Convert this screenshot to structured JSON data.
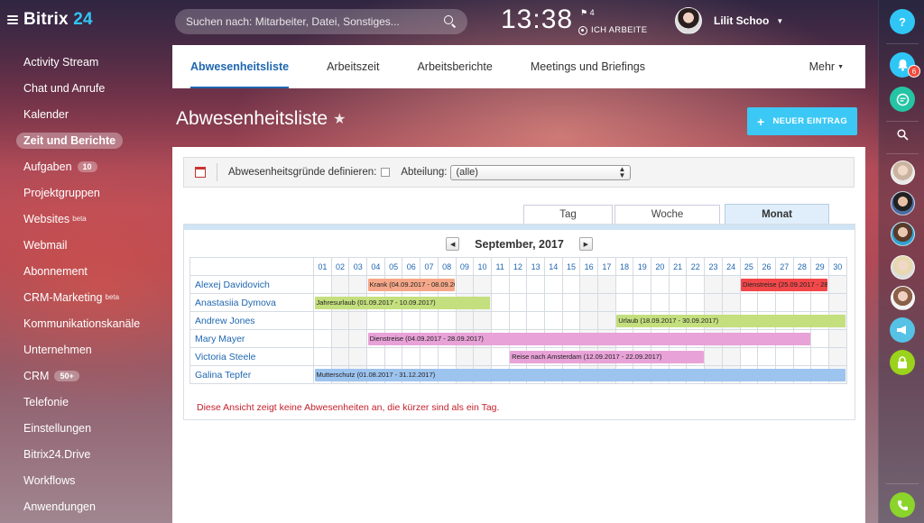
{
  "app": {
    "logo_prefix": "Bitrix",
    "logo_suffix": "24"
  },
  "sidebar": {
    "items": [
      {
        "label": "Activity Stream"
      },
      {
        "label": "Chat und Anrufe"
      },
      {
        "label": "Kalender"
      },
      {
        "label": "Zeit und Berichte",
        "active": true
      },
      {
        "label": "Aufgaben",
        "badge": "10"
      },
      {
        "label": "Projektgruppen"
      },
      {
        "label": "Websites",
        "sup": "beta"
      },
      {
        "label": "Webmail"
      },
      {
        "label": "Abonnement"
      },
      {
        "label": "CRM-Marketing",
        "sup": "beta"
      },
      {
        "label": "Kommunikationskanäle"
      },
      {
        "label": "Unternehmen"
      },
      {
        "label": "CRM",
        "badge": "50+"
      },
      {
        "label": "Telefonie"
      },
      {
        "label": "Einstellungen"
      },
      {
        "label": "Bitrix24.Drive"
      },
      {
        "label": "Workflows"
      },
      {
        "label": "Anwendungen"
      }
    ]
  },
  "header": {
    "search_placeholder": "Suchen nach: Mitarbeiter, Datei, Sonstiges...",
    "clock": "13:38",
    "flag_count": "4",
    "work_status": "ICH ARBEITE",
    "user_name": "Lilit Schoo"
  },
  "rightbar": {
    "help": "?",
    "notifications_count": "6"
  },
  "nav": {
    "tabs": [
      "Abwesenheitsliste",
      "Arbeitszeit",
      "Arbeitsberichte",
      "Meetings und Briefings"
    ],
    "active": 0,
    "more": "Mehr"
  },
  "page": {
    "title": "Abwesenheitsliste",
    "new_button": "NEUER EINTRAG"
  },
  "filter": {
    "reasons_label": "Abwesenheitsgründe definieren:",
    "department_label": "Abteilung:",
    "department_value": "(alle)"
  },
  "view_tabs": {
    "day": "Tag",
    "week": "Woche",
    "month": "Monat",
    "active": "month"
  },
  "calendar": {
    "month_title": "September, 2017",
    "days": [
      "01",
      "02",
      "03",
      "04",
      "05",
      "06",
      "07",
      "08",
      "09",
      "10",
      "11",
      "12",
      "13",
      "14",
      "15",
      "16",
      "17",
      "18",
      "19",
      "20",
      "21",
      "22",
      "23",
      "24",
      "25",
      "26",
      "27",
      "28",
      "29",
      "30"
    ],
    "weekend_days": [
      2,
      3,
      9,
      10,
      16,
      17,
      23,
      24,
      30
    ],
    "employees": [
      {
        "name": "Alexej Davidovich",
        "absences": [
          {
            "label": "Krank (04.09.2017 - 08.09.2017)",
            "start": 4,
            "end": 8,
            "color": "#f5a889"
          },
          {
            "label": "Dienstreise (25.09.2017 - 28.09.2017)",
            "start": 25,
            "end": 29,
            "color": "#f2484a"
          }
        ]
      },
      {
        "name": "Anastasiia Dymova",
        "absences": [
          {
            "label": "Jahresurlaub (01.09.2017 - 10.09.2017)",
            "start": 1,
            "end": 10,
            "color": "#c4df7e"
          }
        ]
      },
      {
        "name": "Andrew Jones",
        "absences": [
          {
            "label": "Urlaub (18.09.2017 - 30.09.2017)",
            "start": 18,
            "end": 30,
            "color": "#c4df7e"
          }
        ]
      },
      {
        "name": "Mary Mayer",
        "absences": [
          {
            "label": "Dienstreise (04.09.2017 - 28.09.2017)",
            "start": 4,
            "end": 28,
            "color": "#e8a2d8"
          }
        ]
      },
      {
        "name": "Victoria Steele",
        "absences": [
          {
            "label": "Reise nach Amsterdam (12.09.2017 - 22.09.2017)",
            "start": 12,
            "end": 22,
            "color": "#e8a2d8"
          }
        ]
      },
      {
        "name": "Galina Tepfer",
        "absences": [
          {
            "label": "Mutterschutz (01.08.2017 - 31.12.2017)",
            "start": 1,
            "end": 30,
            "color": "#9dc3ef"
          }
        ]
      }
    ],
    "note": "Diese Ansicht zeigt keine Abwesenheiten an, die kürzer sind als ein Tag."
  }
}
